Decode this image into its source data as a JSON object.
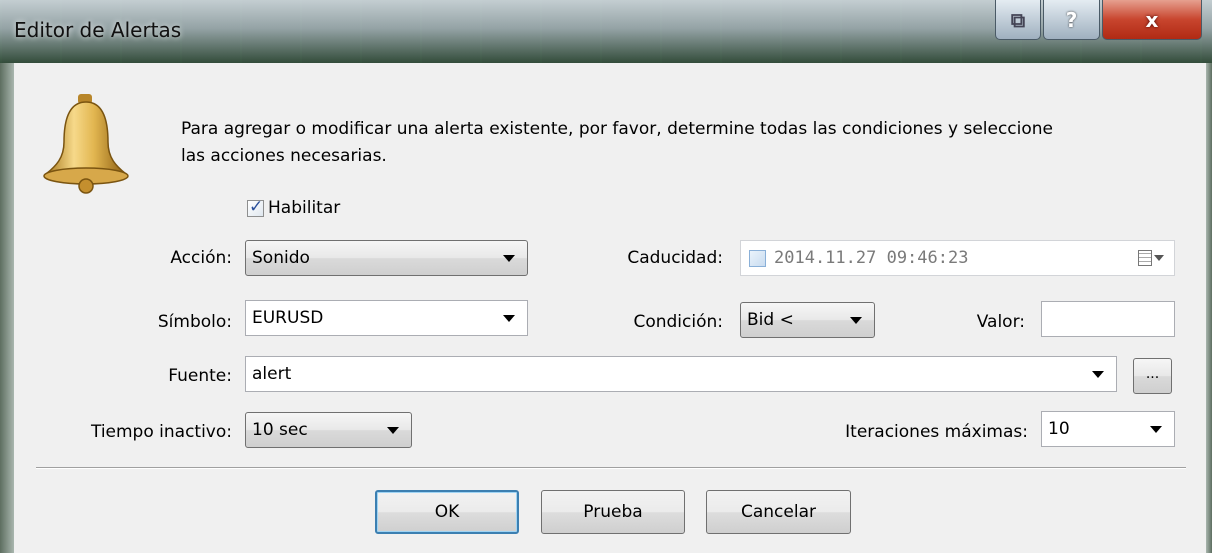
{
  "window": {
    "title": "Editor de Alertas",
    "controls": {
      "restore": "⧉",
      "help": "?",
      "close": "x"
    }
  },
  "intro_text": "Para agregar o modificar una alerta existente, por favor, determine todas las condiciones y seleccione las acciones necesarias.",
  "enable": {
    "label": "Habilitar",
    "checked": true
  },
  "fields": {
    "accion": {
      "label": "Acción:",
      "value": "Sonido"
    },
    "caducidad": {
      "label": "Caducidad:",
      "value": "2014.11.27 09:46:23",
      "checked": false
    },
    "simbolo": {
      "label": "Símbolo:",
      "value": "EURUSD"
    },
    "condicion": {
      "label": "Condición:",
      "value": "Bid <"
    },
    "valor": {
      "label": "Valor:",
      "value": ""
    },
    "fuente": {
      "label": "Fuente:",
      "value": "alert",
      "browse": "..."
    },
    "tiempo_inactivo": {
      "label": "Tiempo inactivo:",
      "value": "10 sec"
    },
    "iteraciones": {
      "label": "Iteraciones máximas:",
      "value": "10"
    }
  },
  "buttons": {
    "ok": "OK",
    "prueba": "Prueba",
    "cancelar": "Cancelar"
  },
  "colors": {
    "accent_focus": "#3c7fb1",
    "close_button": "#c8452e",
    "dialog_bg": "#f0f0f0"
  },
  "icons": {
    "dialog": "bell-icon",
    "calendar": "calendar-icon"
  }
}
